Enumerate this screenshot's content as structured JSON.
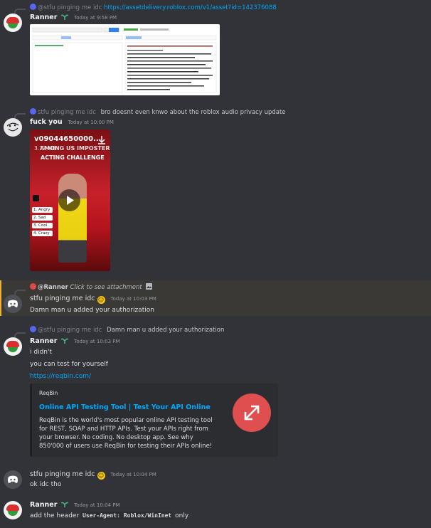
{
  "messages": {
    "m1": {
      "reply_author": "@stfu pinging me idc",
      "reply_link": "https://assetdelivery.roblox.com/v1/asset?id=142376088",
      "author": "Ranner",
      "timestamp": "Today at 9:58 PM"
    },
    "m2": {
      "reply_author": "stfu pinging me idc",
      "reply_text": "bro doesnt even knwo about the roblox audio privacy update",
      "author": "fuck you",
      "timestamp": "Today at 10:00 PM",
      "video": {
        "filename": "v09044650000...",
        "size": "3.77 MB",
        "overlay_lines": [
          "AMONG US IMPOSTER",
          "ACTING CHALLENGE"
        ],
        "poll": [
          "1. Angry",
          "2. Sad",
          "3. Cool",
          "4. Crazy"
        ]
      }
    },
    "m3": {
      "reply_author": "@Ranner",
      "reply_text": "Click to see attachment",
      "author": "stfu pinging me idc",
      "timestamp": "Today at 10:03 PM",
      "text": "Damn man u added your authorization"
    },
    "m4": {
      "reply_author": "@stfu pinging me idc",
      "reply_text": "Damn man u added your authorization",
      "author": "Ranner",
      "timestamp": "Today at 10:03 PM",
      "lines": [
        "i didn't",
        "you can test for yourself"
      ],
      "link": "https://reqbin.com/",
      "embed": {
        "provider": "ReqBin",
        "title": "Online API Testing Tool | Test Your API Online",
        "description": "ReqBin is the world's most popular online API testing tool for REST, SOAP and HTTP APIs. Test your APIs right from your browser. No coding. No desktop app. See why 850'000 of users use ReqBin for testing their APIs online!"
      }
    },
    "m5": {
      "author": "stfu pinging me idc",
      "timestamp": "Today at 10:04 PM",
      "text": "ok idc tho"
    },
    "m6": {
      "author": "Ranner",
      "timestamp": "Today at 10:04 PM",
      "text_before": "add the header",
      "code": "User-Agent: Roblox/WinInet",
      "text_after": "only"
    }
  },
  "colors": {
    "background": "#313338",
    "link": "#00a8fc",
    "highlight": "#f0b232",
    "embed_thumb": "#e04f4f"
  }
}
